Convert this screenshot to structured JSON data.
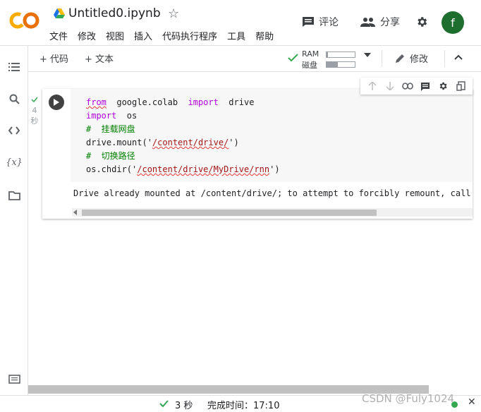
{
  "app": {
    "logo": "CO",
    "title": "Untitled0.ipynb"
  },
  "menu": [
    "文件",
    "修改",
    "视图",
    "插入",
    "代码执行程序",
    "工具",
    "帮助"
  ],
  "header_actions": {
    "comments": "评论",
    "share": "分享",
    "avatar_letter": "f"
  },
  "toolbar": {
    "add_code": "+ 代码",
    "add_text": "+ 文本",
    "ram_label": "RAM",
    "disk_label": "磁盘",
    "edit": "修改",
    "ram_fraction": 0.05,
    "disk_fraction": 0.4
  },
  "cell": {
    "exec_time_num": "4",
    "exec_time_unit": "秒",
    "code_lines": [
      "from  google.colab  import  drive",
      "import  os",
      "#  挂载网盘",
      "drive.mount('/content/drive/')",
      "#  切换路径",
      "os.chdir('/content/drive/MyDrive/rnn')"
    ],
    "output": "Drive already mounted at /content/drive/; to attempt to forcibly remount, call drive.mount(\"/content/drive/\", force_remount=True)."
  },
  "status": {
    "duration": "3 秒",
    "completed_label": "完成时间：17:10"
  },
  "watermark": "CSDN @Fuly1024",
  "colors": {
    "accent": "#f9ab00",
    "run_button": "#424242",
    "check": "#34a853"
  }
}
